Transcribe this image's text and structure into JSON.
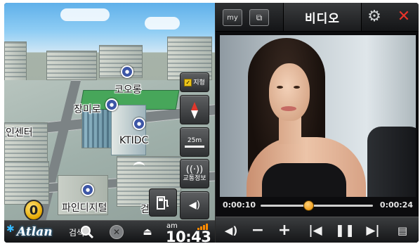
{
  "map": {
    "labels": {
      "kolon": "코오롱",
      "jangmi": "장미로",
      "center": "인센터",
      "ktidc": "KTIDC",
      "finedigital": "파인디지털",
      "partial": "걷"
    },
    "buttons": {
      "map_view": "지형",
      "scale": "25m",
      "traffic": "교통정보"
    },
    "speed_badge": "0"
  },
  "bottom_bar": {
    "brand": "Atlan",
    "search_label": "검색",
    "clock": {
      "ampm": "am",
      "time": "10:43"
    }
  },
  "video": {
    "my_label": "my",
    "title": "비디오",
    "time_current": "0:00:10",
    "time_total": "0:00:24",
    "progress": 0.417
  },
  "colors": {
    "accent_orange": "#f0a020",
    "close_red": "#e8332a",
    "poi_blue": "#3d56a6",
    "brand_blue": "#35b9ff"
  }
}
